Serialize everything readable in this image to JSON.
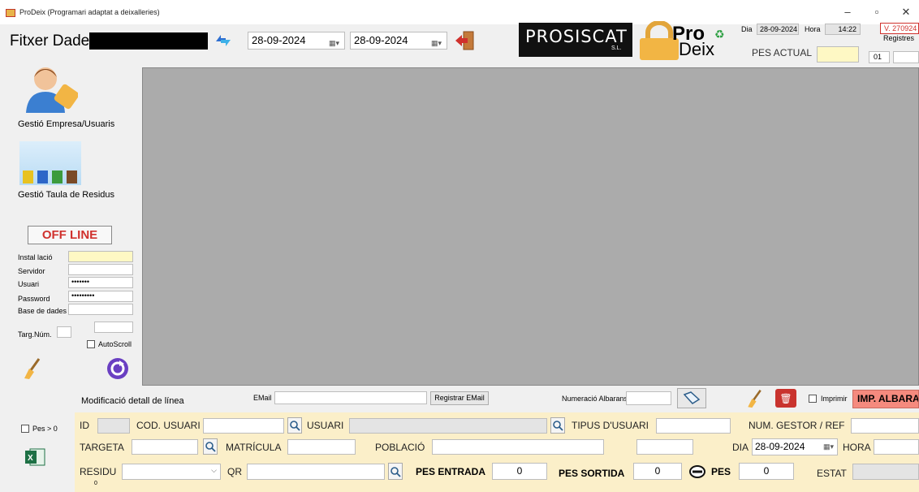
{
  "window": {
    "title": "ProDeix (Programari adaptat a deixalleries)",
    "min": "–",
    "max": "▫",
    "close": "✕"
  },
  "header": {
    "fitxer_label": "Fitxer Dades",
    "date_from": "28-09-2024",
    "date_to": "28-09-2024",
    "brand": "PROSISCAT",
    "brand_sub": "S.L.",
    "logo_pro": "Pro",
    "logo_deix": "Deix",
    "dia_label": "Dia",
    "dia_value": "28-09-2024",
    "hora_label": "Hora",
    "hora_value": "14:22",
    "version": "V. 270924",
    "registres_label": "Registres",
    "pes_actual_label": "PES ACTUAL",
    "counter": "01"
  },
  "sidebar": {
    "empresa_label": "Gestió Empresa/Usuaris",
    "residus_label": "Gestió Taula de Residus",
    "status": "OFF LINE",
    "instalacio_label": "Instal lació",
    "servidor_label": "Servidor",
    "usuari_label": "Usuari",
    "usuari_value": "•••••••",
    "password_label": "Password",
    "password_value": "•••••••••",
    "bd_label": "Base de dades",
    "targ_label": "Targ.Núm.",
    "autoscroll_label": "AutoScroll",
    "pes0_label": "Pes > 0"
  },
  "toolbar": {
    "modificacio_label": "Modificació detall de línea",
    "email_label": "EMail",
    "registrar_email": "Registrar EMail",
    "numeracio_label": "Numeració Albarans",
    "imprimir_label": "Imprimir",
    "imp_albara": "IMP. ALBARA"
  },
  "form": {
    "id_label": "ID",
    "cod_usuari_label": "COD. USUARI",
    "usuari_label": "USUARI",
    "tipus_label": "TIPUS D'USUARI",
    "num_gestor_label": "NUM. GESTOR / REF",
    "targeta_label": "TARGETA",
    "matricula_label": "MATRÍCULA",
    "poblacio_label": "POBLACIÓ",
    "dia_label": "DIA",
    "dia_value": "28-09-2024",
    "hora_label": "HORA",
    "residu_label": "RESIDU",
    "residu_sub": "0",
    "qr_label": "QR",
    "pes_entrada_label": "PES ENTRADA",
    "pes_entrada_value": "0",
    "pes_sortida_label": "PES SORTIDA",
    "pes_sortida_value": "0",
    "pes_label": "PES",
    "pes_value": "0",
    "estat_label": "ESTAT"
  },
  "colors": {
    "grid": "#ababab",
    "offline": "#d0312d",
    "imp": "#f58a7e",
    "yellow": "#fef8c4"
  }
}
